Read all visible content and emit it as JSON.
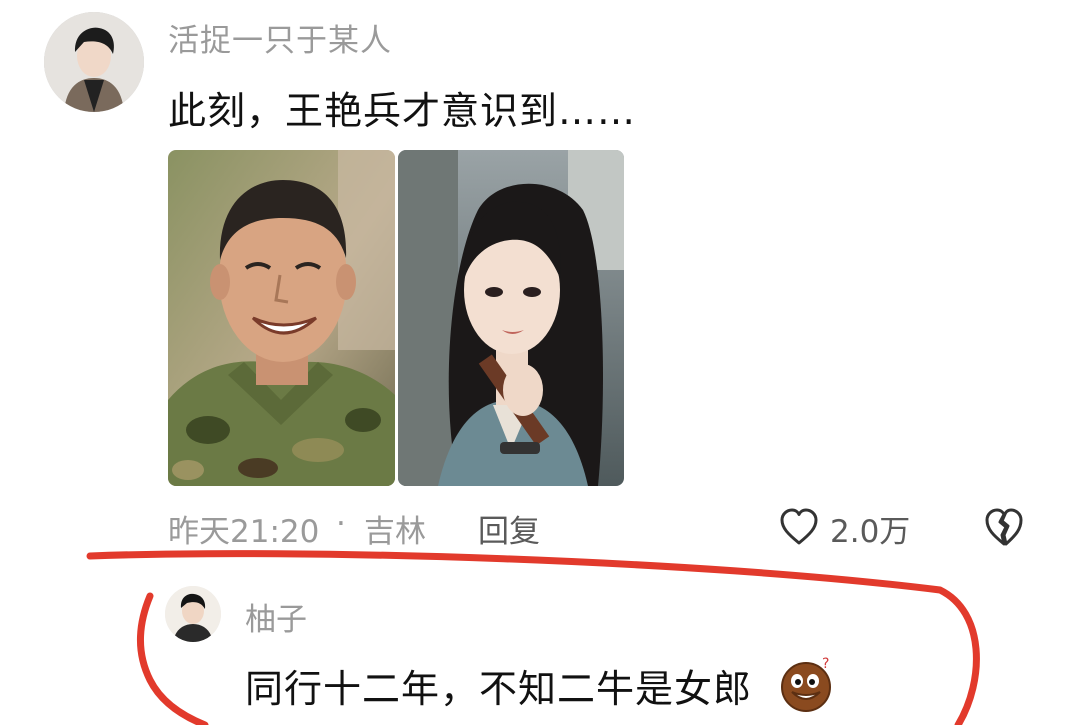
{
  "comment": {
    "username": "活捉一只于某人",
    "text": "此刻，王艳兵才意识到……",
    "time": "昨天21:20",
    "separator": "·",
    "location": "吉林",
    "reply_label": "回复",
    "like_count": "2.0万",
    "icons": {
      "like": "heart-outline-icon",
      "dislike": "broken-heart-icon"
    }
  },
  "reply": {
    "username": "柚子",
    "text": "同行十二年，不知二牛是女郎",
    "emoji": "confused-face-emoji-icon"
  },
  "colors": {
    "annotation": "#e23a2c",
    "meta_text": "#9a9a9a",
    "body_text": "#111111"
  }
}
